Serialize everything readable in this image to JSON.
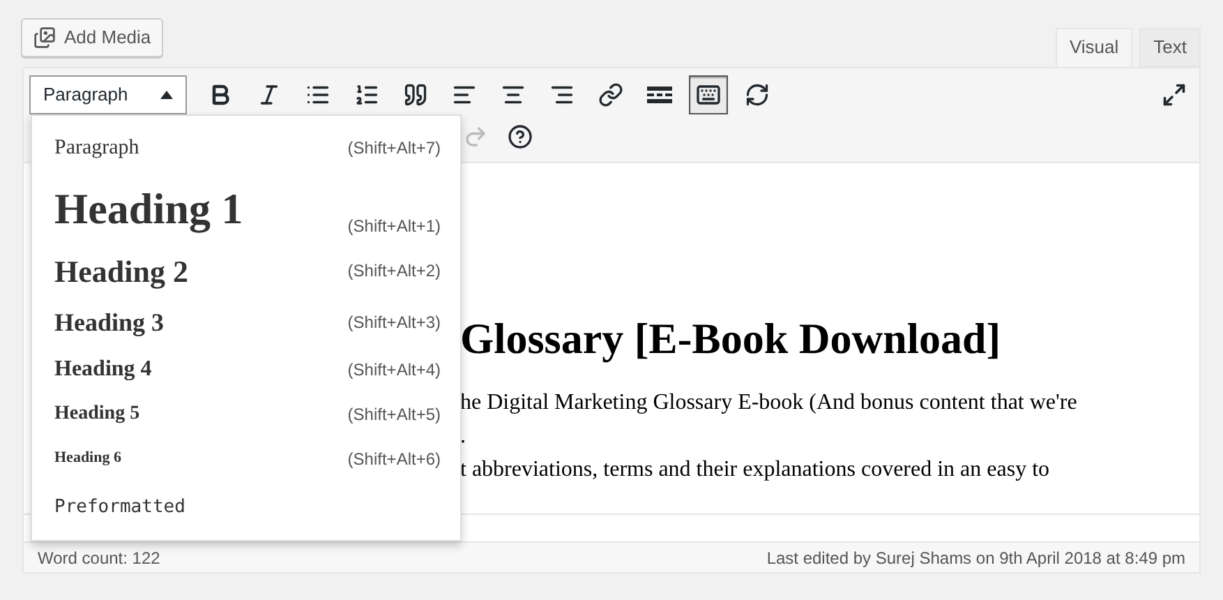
{
  "add_media": {
    "label": "Add Media"
  },
  "tabs": [
    {
      "label": "Visual",
      "selected": true
    },
    {
      "label": "Text",
      "selected": false
    }
  ],
  "format_select": {
    "value": "Paragraph",
    "open": true
  },
  "toolbar_row_1": [
    {
      "kind": "bold",
      "pressed": false
    },
    {
      "kind": "italic",
      "pressed": false
    },
    {
      "kind": "bullets",
      "pressed": false
    },
    {
      "kind": "numbers",
      "pressed": false
    },
    {
      "kind": "quote",
      "pressed": false
    },
    {
      "kind": "align-left",
      "pressed": false
    },
    {
      "kind": "align-center",
      "pressed": false
    },
    {
      "kind": "align-right",
      "pressed": false
    },
    {
      "kind": "link",
      "pressed": false
    },
    {
      "kind": "read-more",
      "pressed": false
    },
    {
      "kind": "toolbar-toggle",
      "pressed": true
    },
    {
      "kind": "refresh",
      "pressed": false
    }
  ],
  "toolbar_row_2": [
    {
      "kind": "redo",
      "disabled": true
    },
    {
      "kind": "help",
      "disabled": false
    }
  ],
  "format_menu": [
    {
      "kind": "p",
      "label": "Paragraph",
      "shortcut": "(Shift+Alt+7)"
    },
    {
      "kind": "h1",
      "label": "Heading 1",
      "shortcut": "(Shift+Alt+1)"
    },
    {
      "kind": "h2",
      "label": "Heading 2",
      "shortcut": "(Shift+Alt+2)"
    },
    {
      "kind": "h3",
      "label": "Heading 3",
      "shortcut": "(Shift+Alt+3)"
    },
    {
      "kind": "h4",
      "label": "Heading 4",
      "shortcut": "(Shift+Alt+4)"
    },
    {
      "kind": "h5",
      "label": "Heading 5",
      "shortcut": "(Shift+Alt+5)"
    },
    {
      "kind": "h6",
      "label": "Heading 6",
      "shortcut": "(Shift+Alt+6)"
    },
    {
      "kind": "pre",
      "label": "Preformatted"
    }
  ],
  "content": {
    "heading": "Glossary [E-Book Download]",
    "lines": [
      "he Digital Marketing Glossary E-book (And bonus content that we're",
      ".",
      "t abbreviations, terms and their explanations covered in an easy to"
    ]
  },
  "status_bar": {
    "word_count": "Word count: 122",
    "last_edited": "Last edited by Surej Shams on 9th April 2018 at 8:49 pm"
  }
}
